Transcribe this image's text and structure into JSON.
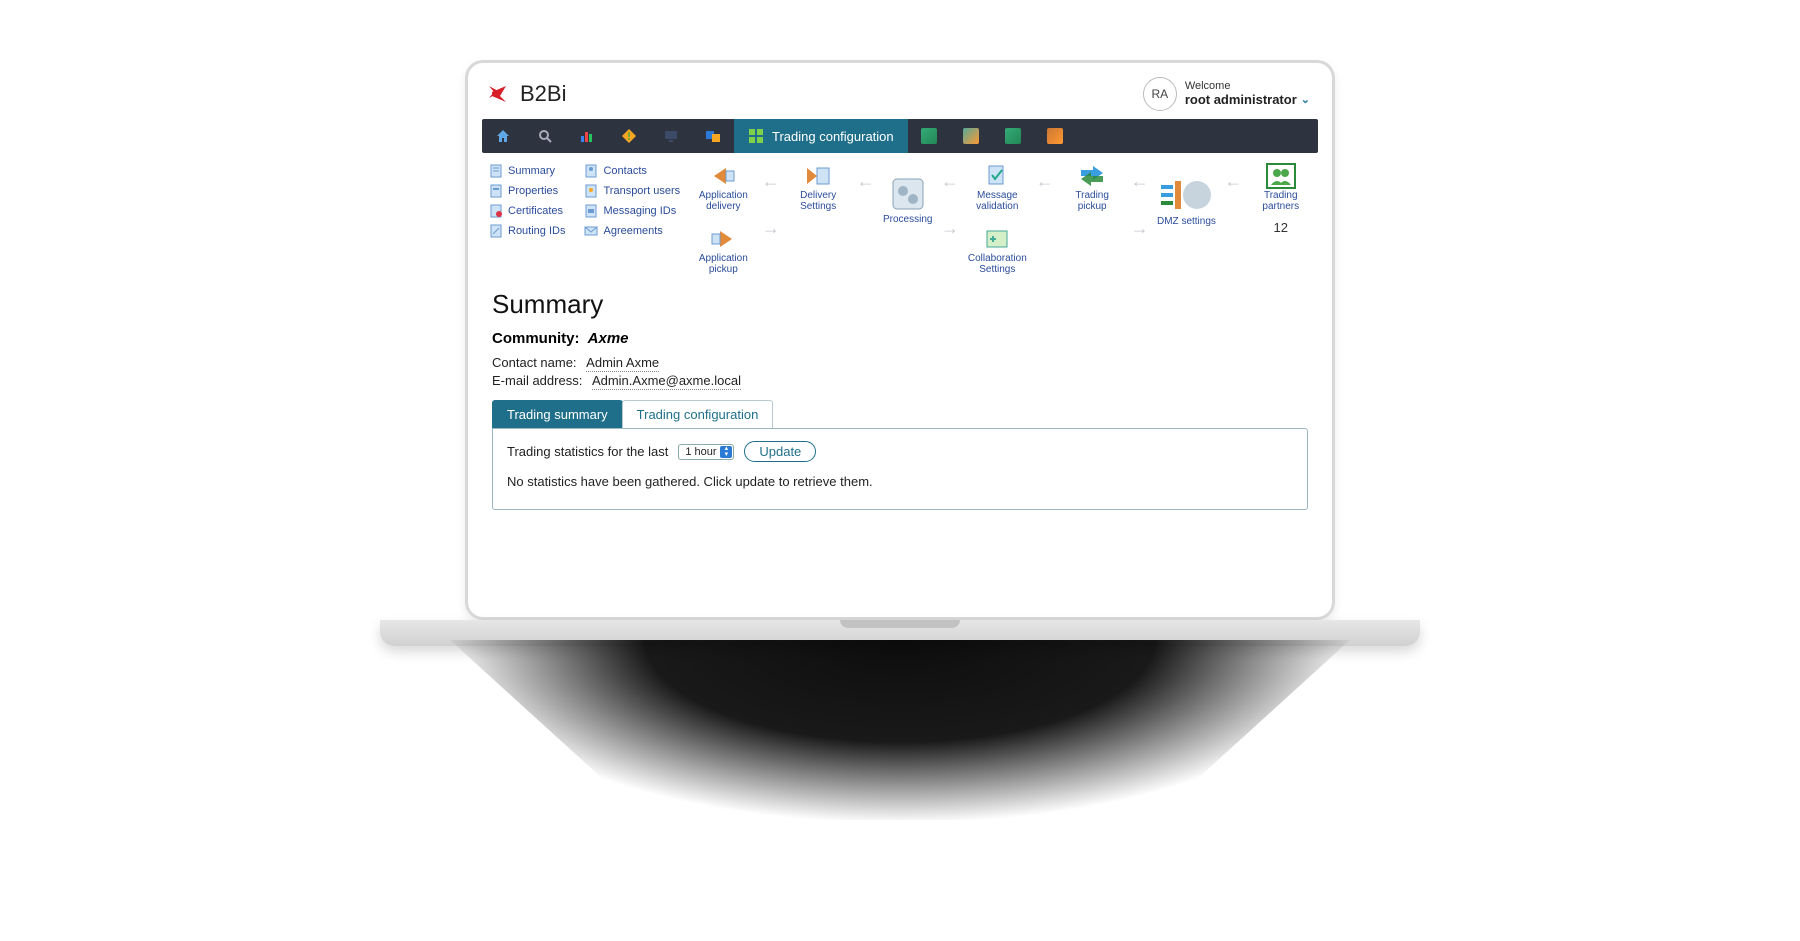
{
  "header": {
    "app_title": "B2Bi",
    "avatar_initials": "RA",
    "welcome_label": "Welcome",
    "username": "root administrator"
  },
  "navbar": {
    "active_label": "Trading configuration"
  },
  "workflow_links": {
    "col1": [
      "Summary",
      "Properties",
      "Certificates",
      "Routing IDs"
    ],
    "col2": [
      "Contacts",
      "Transport users",
      "Messaging IDs",
      "Agreements"
    ]
  },
  "flow": {
    "app_delivery": "Application\ndelivery",
    "app_pickup": "Application\npickup",
    "delivery_settings": "Delivery\nSettings",
    "processing": "Processing",
    "message_validation": "Message\nvalidation",
    "collab_settings": "Collaboration\nSettings",
    "trading_pickup": "Trading\npickup",
    "dmz_settings": "DMZ\nsettings",
    "trading_partners": "Trading partners",
    "trading_partners_count": "12"
  },
  "summary": {
    "heading": "Summary",
    "community_label": "Community:",
    "community_name": "Axme",
    "contact_label": "Contact name:",
    "contact_value": "Admin Axme",
    "email_label": "E-mail address:",
    "email_value": "Admin.Axme@axme.local"
  },
  "tabs": {
    "active": "Trading summary",
    "second": "Trading configuration"
  },
  "panel": {
    "stats_prefix": "Trading statistics for the last",
    "period": "1 hour",
    "update_label": "Update",
    "empty_msg": "No statistics have been gathered. Click update to retrieve them."
  }
}
